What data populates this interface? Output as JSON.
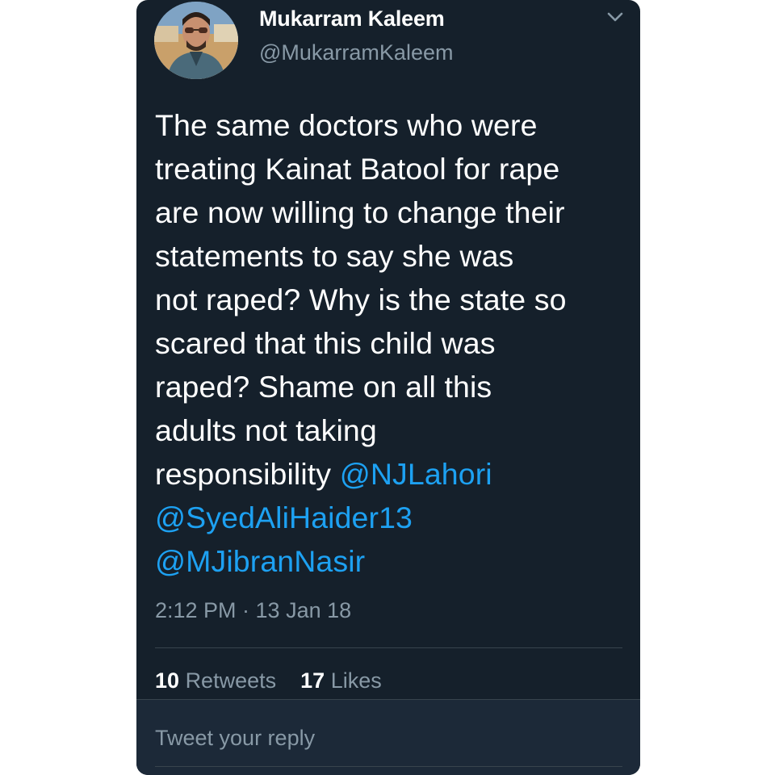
{
  "tweet": {
    "author": {
      "display_name": "Mukarram Kaleem",
      "handle": "@MukarramKaleem",
      "avatar_icon": "user-avatar"
    },
    "menu_icon": "chevron-down-icon",
    "text_lines": [
      "The same doctors who were",
      "treating Kainat Batool for rape",
      "are now willing to change their",
      "statements to say she was",
      "not raped? Why is the state so",
      "scared that this child was",
      "raped? Shame on all this",
      "adults not taking",
      "responsibility "
    ],
    "mentions": [
      "@NJLahori",
      "@SyedAliHaider13",
      "@MJibranNasir"
    ],
    "timestamp": "2:12 PM · 13 Jan 18",
    "stats": {
      "retweets_count": "10",
      "retweets_label": "Retweets",
      "likes_count": "17",
      "likes_label": "Likes"
    }
  },
  "reply": {
    "placeholder": "Tweet your reply"
  },
  "colors": {
    "background": "#15202b",
    "text": "#ffffff",
    "muted": "#8899a6",
    "link": "#1da1f2",
    "divider": "#38444d"
  }
}
